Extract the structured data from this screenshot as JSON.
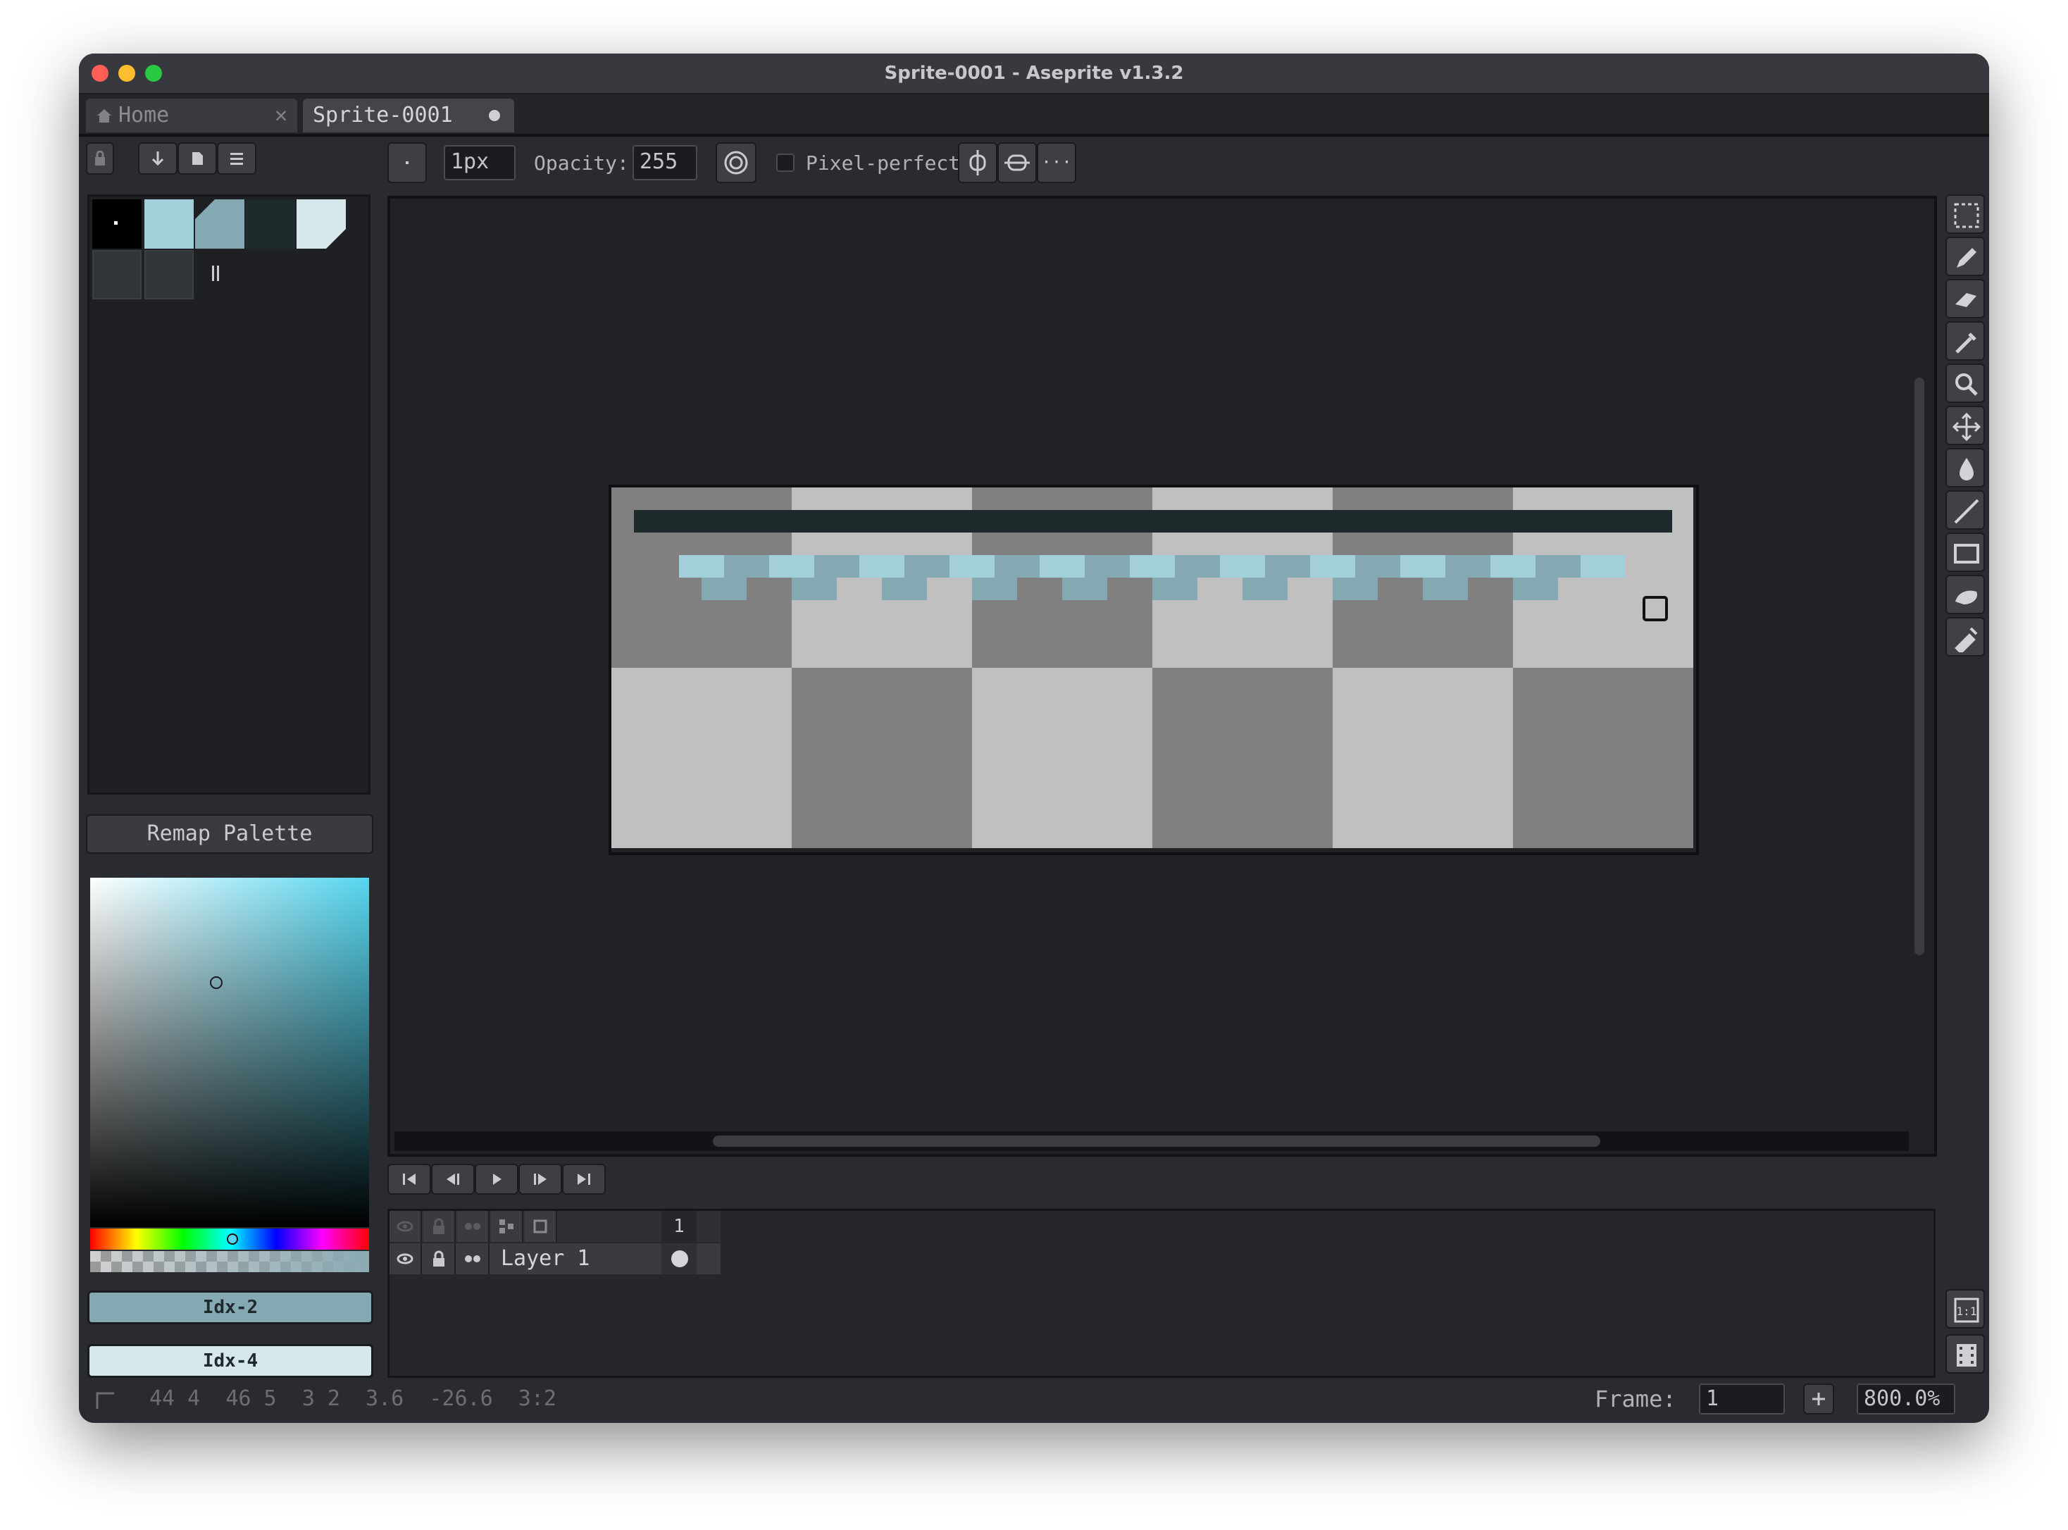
{
  "window": {
    "title": "Sprite-0001 - Aseprite v1.3.2",
    "traffic_lights": [
      "#ff5f57",
      "#febc2e",
      "#28c840"
    ]
  },
  "tabs": [
    {
      "label": "Home",
      "close": "✕",
      "active": false
    },
    {
      "label": "Sprite-0001",
      "active": true,
      "modified": true
    }
  ],
  "toolbar": {
    "brush_size": "1px",
    "opacity_label": "Opacity:",
    "opacity_value": "255",
    "pixel_perfect_label": "Pixel-perfect",
    "pixel_perfect_checked": false,
    "more": "···"
  },
  "palette": {
    "swatches": [
      "#000000",
      "#a3cfda",
      "#85a9b2",
      "#1f2a2d",
      "#d6e8ec",
      "#2f3538",
      "#2f3538"
    ],
    "remap_label": "Remap Palette",
    "fg_label": "Idx-2",
    "fg_color": "#85a9b2",
    "bg_label": "Idx-4",
    "bg_color": "#d6e8ec"
  },
  "canvas": {
    "checker_light": "#c0c0c0",
    "checker_dark": "#808080",
    "stroke_dark": "#1f2a2d",
    "stroke_light": "#a3cfda",
    "stroke_mid": "#85a9b2"
  },
  "timeline": {
    "frame_header": "1",
    "layer_name": "Layer 1"
  },
  "status": {
    "text": "44 4  46 5  3 2  3.6  -26.6  3:2",
    "frame_label": "Frame:",
    "frame_value": "1",
    "zoom": "800.0%"
  },
  "right_tools": [
    "marquee-icon",
    "pencil-icon",
    "eraser-icon",
    "eyedropper-icon",
    "zoom-icon",
    "move-icon",
    "bucket-icon",
    "line-icon",
    "rectangle-icon",
    "blur-icon",
    "spray-icon"
  ]
}
